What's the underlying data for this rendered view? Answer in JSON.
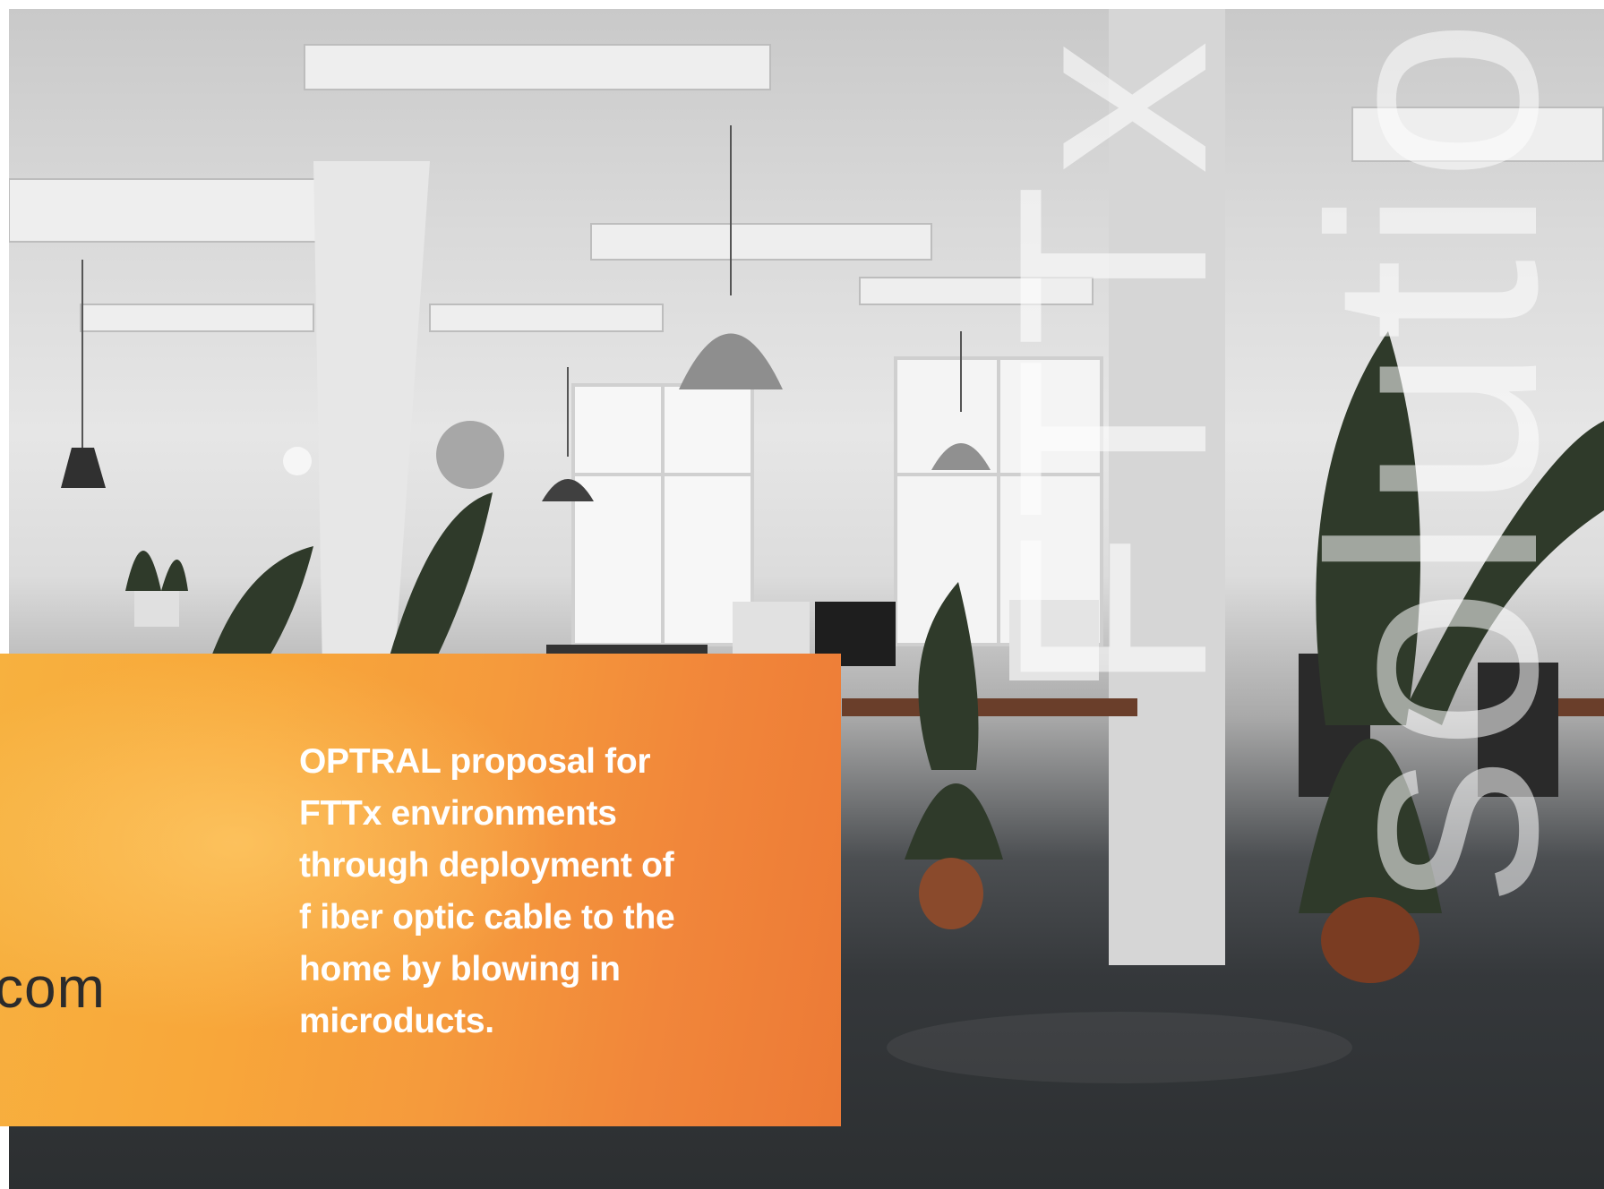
{
  "card": {
    "fragment": "com",
    "description_lines": [
      "OPTRAL proposal for",
      "FTTx environments",
      "through deployment of",
      "f iber optic cable to the",
      "home by blowing in",
      "microducts."
    ]
  },
  "vertical_text": {
    "primary": "FTTx",
    "secondary": "solution"
  },
  "colors": {
    "card_orange": "#f39a3b",
    "text_white": "#ffffff",
    "fragment_dark": "#2b2b2b"
  }
}
